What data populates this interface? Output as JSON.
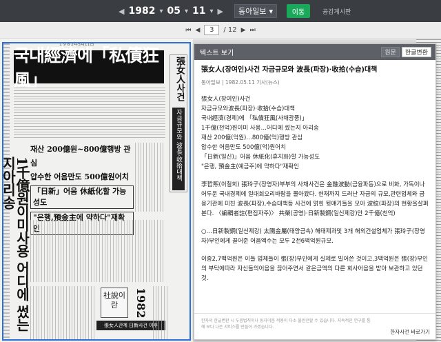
{
  "topbar": {
    "prev_nav": "◀",
    "year": "1982",
    "month": "05",
    "day": "11",
    "next_nav": "▶",
    "paper_name": "동아일보",
    "go_label": "이동",
    "public_label": "공감게시판"
  },
  "pager": {
    "first": "⏮",
    "prev": "◀",
    "current_page": "3",
    "total_pages": "/ 12",
    "next": "▶",
    "last": "⏭"
  },
  "newspaper": {
    "masthead_date": "1 9 8 2年5月11日",
    "headline_main": "국내經濟에「私債狂風」",
    "side_tab_top": "張女人사건",
    "side_tab_bottom": "자금규모와 波長·收拾대책",
    "vertical_headline": "1千億원이미사용 어디에 썼는지아리송",
    "sub_line1": "재산 200億원~800億행방 관심",
    "sub_line2": "압수한 어음만도 500億원어치",
    "sub_line3": "「日新」어음 休紙化할 가능성도",
    "sub_line4": "\"은행,預金主에 약하다\"재확인",
    "small_box_text": "社說이란",
    "dark_banner_text": "張女人관계 日新사건 이후",
    "side_date": "1982"
  },
  "popup": {
    "header_title": "텍스트 보기",
    "btn_original": "원문",
    "btn_convert": "한글변환",
    "article_title": "張女人(장여인)사건 자금규모와 波長(파장)·收拾(수습)대책",
    "article_meta": "동아일보 | 1982.05.11 기사(뉴스)",
    "lines": [
      "張女人(장여인)사건",
      "자금규모와波長(파장)·收拾(수습)대책",
      "국내經濟(경제)에 「私債狂風(사채광풍)」",
      "1千億(천억)원이미 사용…어디에 썼는지 아리송",
      "재산 200億(억원)…800億(억)행방 관심",
      "압수한 어음만도 500億(억)원어치",
      "「日新(일신)」어음 休紙化(휴지화)할 가능성도",
      "\"은행, 預金主(예금주)에 약하다\"재확인"
    ],
    "para2": "李哲熙(이철희) 張玲子(장영자)부부의 사채사건은 金融波動(금융파동)으로 비화, 가독이나 어두운 국내경제에 일대회오리바람을 몰아왔다. 현재까지 드러난 자금의 규모,관련업체와 금융기관에 미친 波長(파장),수습대책등 사건에 얽힌 뒷얘기들을 모아 波紋(파장)의 현황을살펴본다. 〈編輯者註(편집자주)〉 共榮(공영)·日新製鋼(일신제강)만 2千億(천억)",
    "para3": "○…日新製鋼(일신제강) 太陽金屬(태양금속) 해태제과및 3개 해외건설업체가 張玲子(장영자)부인에게 끌어준 어음액수는 모두 2천6백억원규모.",
    "para4": "이중2,7백억원은 이들 업체들이 張(장)부인에게 실제로 빌어쓴 것이고,3백억원은 張(장)부인의 부탁에따라 자신들의어음을 끊어주면서 같은금액의 다른 회사어음을 받아 보관하고 있던것.",
    "footer_note": "한자의 한글변환 시 두음법칙이나 동자이음 적용이 다소 불완전할 수 있습니다. 지속적인 연구를 통해 보다 나은 서비스를 만들어 가겠습니다.",
    "footer_link": "한자사전 바로가기"
  }
}
